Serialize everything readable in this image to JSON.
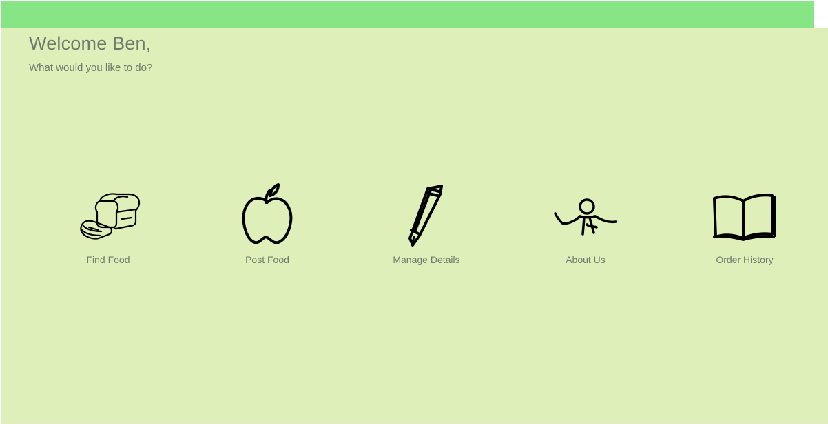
{
  "header": {
    "greeting": "Welcome Ben,",
    "prompt": "What would you like to do?"
  },
  "actions": [
    {
      "label": "Find Food",
      "icon": "bread-icon"
    },
    {
      "label": "Post Food",
      "icon": "apple-icon"
    },
    {
      "label": "Manage Details",
      "icon": "pencil-icon"
    },
    {
      "label": "About Us",
      "icon": "person-icon"
    },
    {
      "label": "Order History",
      "icon": "book-icon"
    }
  ],
  "colors": {
    "topbar": "#88e585",
    "background": "#dfefb9",
    "text": "#6e7a6a"
  }
}
